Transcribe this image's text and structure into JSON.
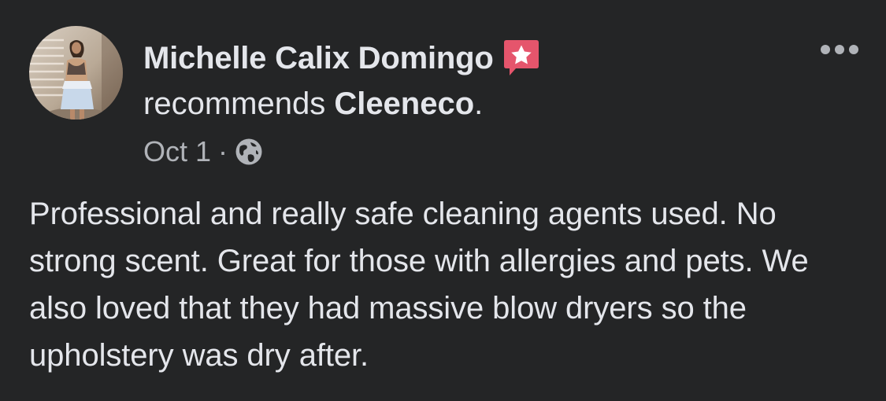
{
  "post": {
    "author_name": "Michelle Calix Domingo",
    "recommends_prefix": "recommends ",
    "page_name": "Cleeneco",
    "recommends_suffix": ".",
    "date": "Oct 1",
    "separator": "·",
    "privacy_icon": "globe-icon",
    "recommend_icon": "recommend-star-icon",
    "more_icon": "more-options-icon",
    "body": "Professional and really safe cleaning agents used. No strong scent. Great for those with allergies and pets. We also loved that they had massive blow dryers so the upholstery was dry after."
  },
  "colors": {
    "background": "#242526",
    "primary_text": "#e4e6eb",
    "secondary_text": "#b0b3b8",
    "recommend_badge": "#e5556c"
  }
}
